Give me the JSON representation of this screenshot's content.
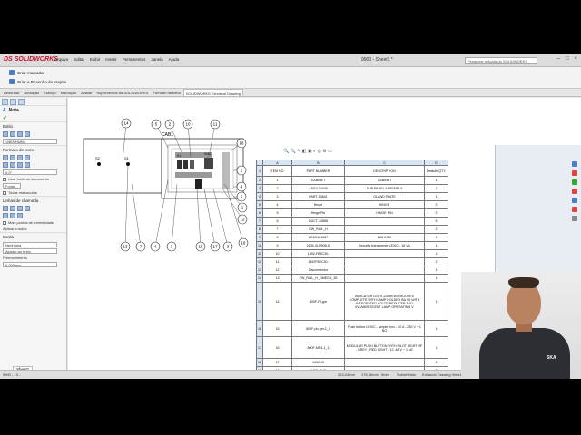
{
  "app": {
    "brand": "SOLIDWORKS",
    "window_title": "9900 - Sheet1 *",
    "menus": [
      "Arquivo",
      "Editar",
      "Exibir",
      "Inserir",
      "Ferramentas",
      "Janela",
      "Ajuda"
    ],
    "search_placeholder": "Pesquisar a Ajuda do SOLIDWORKS"
  },
  "ribbon": {
    "commands": [
      "Criar marcador",
      "Criar a Desenho do projeto"
    ]
  },
  "tabs": [
    "Desenhar",
    "Anotação",
    "Esboço",
    "Marcação",
    "Avaliar",
    "Suplementos do SOLIDWORKS",
    "Formato da folha",
    "SOLIDWORKS Electrical Drawing"
  ],
  "active_tab_index": 7,
  "left_panel": {
    "title": "Nota",
    "sections": {
      "estilo": "Estilo",
      "estilo_value": "<NENHUM>",
      "formato": "Formato de texto",
      "font_value": "0,0°",
      "usar_fonte": "Usar fonte do documento",
      "fonte_btn": "Fonte...",
      "todas_maiusculas": "Todas maiúsculas",
      "linhas_chamada": "Linhas de chamada",
      "mais_pontos": "Mais pontos de extremidade",
      "aplicar": "Aplicar a todos",
      "borda": "Borda",
      "borda_value": "Nenhuma",
      "ajuste": "Ajustar ao texto",
      "preenchimento": "Preenchimento",
      "preench_value": "0,000mm"
    }
  },
  "drawing": {
    "cabinet_label": "CAB1",
    "balloons_top": [
      "14",
      "5",
      "2",
      "10",
      "11"
    ],
    "balloons_right": [
      "18",
      "12",
      "1"
    ],
    "balloons_bottom": [
      "13",
      "7",
      "4",
      "3",
      "15",
      "17",
      "3",
      "16"
    ],
    "side_balloons": [
      "2",
      "4",
      "6"
    ],
    "labels": [
      "S2",
      "S1",
      "K1",
      "KM1"
    ]
  },
  "bom": {
    "col_letters": [
      "A",
      "B",
      "C",
      "D"
    ],
    "headers": [
      "ITEM NO.",
      "PART NUMBER",
      "DESCRIPTION",
      "Default/ QTY."
    ],
    "rows": [
      {
        "item": "1",
        "part": "CABINET",
        "desc": "CABINET",
        "qty": "1",
        "size": ""
      },
      {
        "item": "2",
        "part": "ASSY-04445",
        "desc": "SUB PANEL ASSEMBLY",
        "qty": "1",
        "size": ""
      },
      {
        "item": "3",
        "part": "PART-13841",
        "desc": "GLAND PLATE",
        "qty": "1",
        "size": ""
      },
      {
        "item": "4",
        "part": "Hinge",
        "desc": "HINGE",
        "qty": "2",
        "size": ""
      },
      {
        "item": "5",
        "part": "Hinge Pin",
        "desc": "HINGE PIN",
        "qty": "2",
        "size": ""
      },
      {
        "item": "6",
        "part": "DUCT-13888",
        "desc": "",
        "qty": "5",
        "size": ""
      },
      {
        "item": "7",
        "part": "EW_RAIL_H",
        "desc": "",
        "qty": "2",
        "size": ""
      },
      {
        "item": "8",
        "part": "LC1D121087",
        "desc": "12A COIL",
        "qty": "1",
        "size": ""
      },
      {
        "item": "9",
        "part": "1606-XLP50B-E",
        "desc": "Security transformer LEXIC - 16 VA",
        "qty": "1",
        "size": ""
      },
      {
        "item": "10",
        "part": "1492-FB3C30-",
        "desc": "",
        "qty": "1",
        "size": ""
      },
      {
        "item": "11",
        "part": "1492FB2C30-",
        "desc": "",
        "qty": "2",
        "size": ""
      },
      {
        "item": "12",
        "part": "Disconnector",
        "desc": "",
        "qty": "1",
        "size": ""
      },
      {
        "item": "13",
        "part": "EW_RAIL_H_OMEGA_35",
        "desc": "",
        "qty": "1",
        "size": ""
      },
      {
        "item": "14",
        "part": "800F-PI-gm",
        "desc": "INDICATOR LIGHT,22MM,W/GROOVES COMPLETE WITH LAMP HOLDER BA 9S WITH INTEGRATED VOLTG REDUCER AND INCANDESCENT LAMP OPERATING V",
        "qty": "1",
        "size": "tall"
      },
      {
        "item": "15",
        "part": "800F-pb-gm-1_1",
        "desc": "Push button LEXIC - simple func - 20 A - 250 V ~ 1 NO",
        "qty": "1",
        "size": "med"
      },
      {
        "item": "16",
        "part": "800F-MP4-1_1",
        "desc": "MODULAR PUSH BUTTON WITH PILOT LIGHT RF - GREY - RED LIGHT - 12..48 V ~ 1 NC",
        "qty": "1",
        "size": "mid"
      },
      {
        "item": "17",
        "part": "1492-J3",
        "desc": "",
        "qty": "4",
        "size": ""
      },
      {
        "item": "18",
        "part": "1492-J3-G",
        "desc": "",
        "qty": "2",
        "size": ""
      },
      {
        "item": "19",
        "part": "Harness_21-9168",
        "desc": "",
        "qty": "1",
        "size": ""
      },
      {
        "item": "20",
        "part": "Harness_23-9168",
        "desc": "",
        "qty": "1",
        "size": ""
      },
      {
        "item": "21",
        "part": "Harness_25-9168",
        "desc": "",
        "qty": "1",
        "size": ""
      },
      {
        "item": "22",
        "part": "Harness_27-9168",
        "desc": "",
        "qty": "1",
        "size": ""
      },
      {
        "item": "23",
        "part": "Harness_29-9168",
        "desc": "",
        "qty": "1",
        "size": ""
      }
    ]
  },
  "sheet_tab": "Sheet1",
  "status": {
    "left": "9900 - 13 -",
    "coords": "253,03mm",
    "z": "176,36mm",
    "val": "0mm",
    "state": "Subdefinido",
    "mode": "Editando Drawing View1"
  },
  "person_badge": "SKA",
  "colors": {
    "accent": "#c8102e",
    "table_header": "#d7e4f3"
  }
}
